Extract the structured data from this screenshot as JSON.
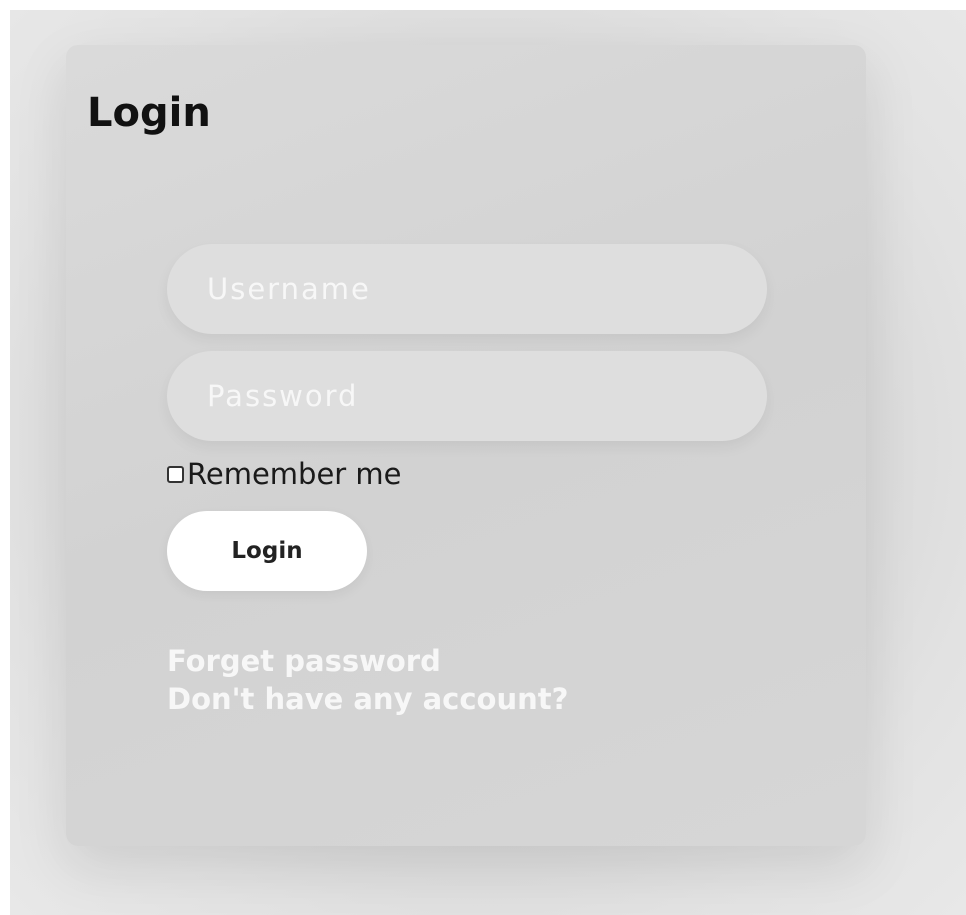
{
  "login_form": {
    "title": "Login",
    "username_placeholder": "Username",
    "password_placeholder": "Password",
    "remember_label": "Remember me",
    "remember_checked": false,
    "submit_label": "Login",
    "forget_password_link": "Forget password",
    "no_account_link": "Don't have any account?"
  },
  "colors": {
    "background": "#d6d6d6",
    "card": "#d4d4d4",
    "field": "#dedede",
    "placeholder": "#f7f7f7",
    "button": "#ffffff",
    "link": "#f7f7f7",
    "title": "#111111"
  }
}
